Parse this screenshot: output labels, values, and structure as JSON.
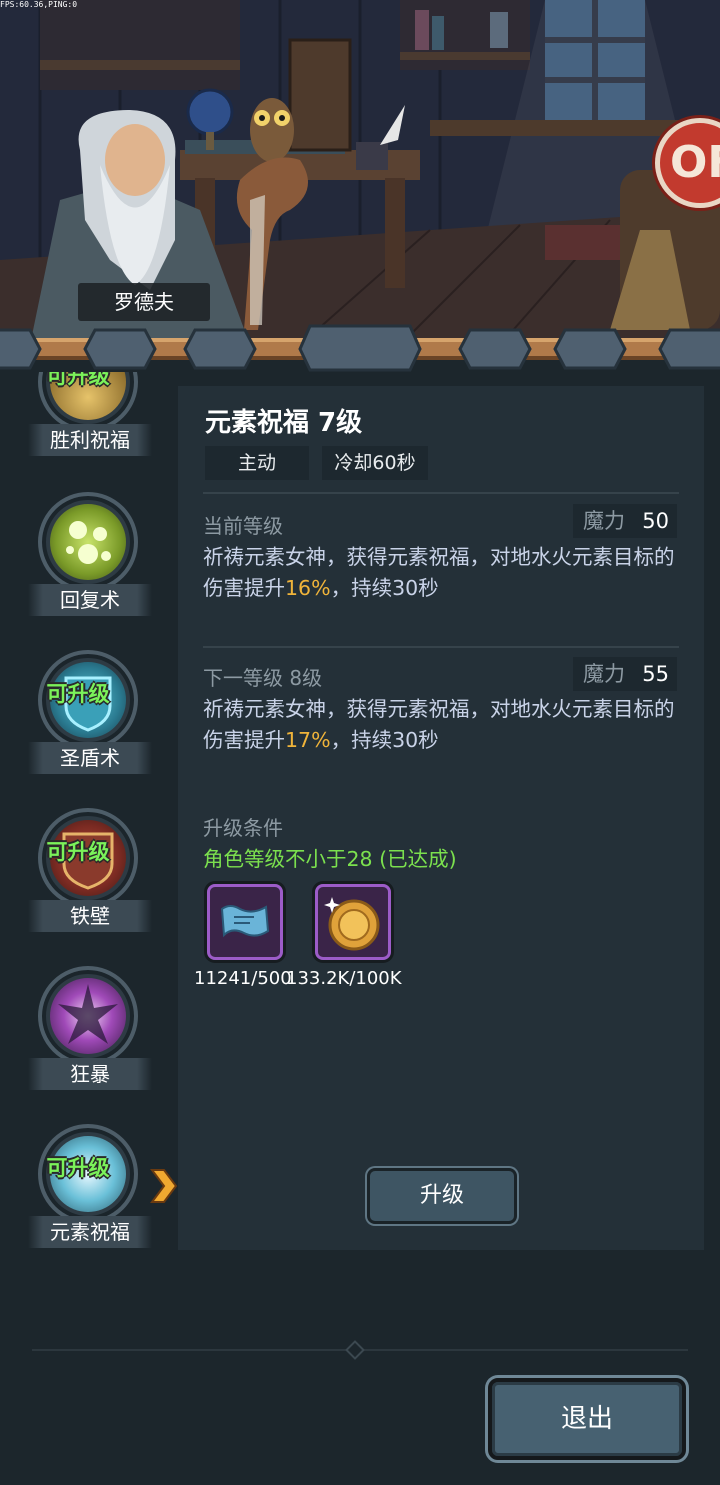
{
  "debug": {
    "fps_text": "FPS:60.36,PING:0"
  },
  "scene": {
    "npc_name": "罗德夫",
    "ribbon_icon": "ribbon-icon"
  },
  "skills": [
    {
      "name": "胜利祝福",
      "badge": "可升级"
    },
    {
      "name": "回复术",
      "badge": ""
    },
    {
      "name": "圣盾术",
      "badge": "可升级"
    },
    {
      "name": "铁壁",
      "badge": "可升级"
    },
    {
      "name": "狂暴",
      "badge": ""
    },
    {
      "name": "元素祝福",
      "badge": "可升级",
      "selected": true
    }
  ],
  "detail": {
    "title": "元素祝福 7级",
    "type_tag": "主动",
    "cooldown_tag": "冷却60秒",
    "current": {
      "heading": "当前等级",
      "mana_label": "魔力",
      "mana_value": "50",
      "desc_before": "祈祷元素女神，获得元素祝福，对地水火元素目标的伤害提升",
      "desc_highlight": "16%",
      "desc_after": "，持续30秒"
    },
    "next": {
      "heading": "下一等级 8级",
      "mana_label": "魔力",
      "mana_value": "55",
      "desc_before": "祈祷元素女神，获得元素祝福，对地水火元素目标的伤害提升",
      "desc_highlight": "17%",
      "desc_after": "，持续30秒"
    },
    "condition_heading": "升级条件",
    "condition_text": "角色等级不小于28 (已达成)",
    "materials": [
      {
        "icon": "scroll-icon",
        "count": "11241/500"
      },
      {
        "icon": "gold-coin-icon",
        "count": "133.2K/100K"
      }
    ],
    "upgrade_label": "升级"
  },
  "footer": {
    "exit_label": "退出"
  },
  "colors": {
    "highlight": "#f0b43a",
    "condition_met": "#7be04e",
    "upgradable_badge": "#7bf25a",
    "panel_bg": "#243038",
    "page_bg": "#1c262c"
  }
}
